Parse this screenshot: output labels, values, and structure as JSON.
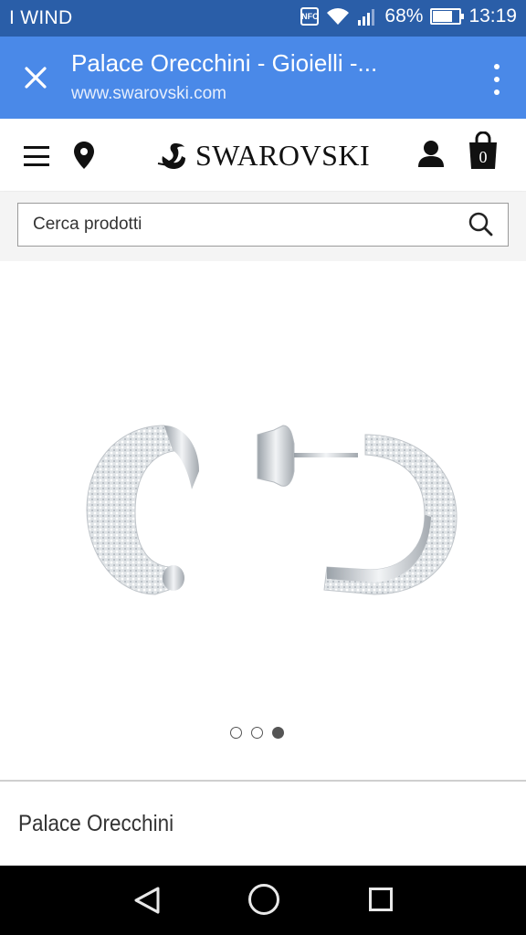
{
  "status_bar": {
    "carrier": "I WIND",
    "battery_text": "68%",
    "battery_level": 0.68,
    "time": "13:19",
    "nfc_label": "NFC",
    "icons": [
      "nfc-icon",
      "wifi-icon",
      "signal-icon",
      "battery-icon"
    ]
  },
  "custom_tab": {
    "title": "Palace Orecchini - Gioielli -...",
    "url": "www.swarovski.com",
    "icons": [
      "close-icon",
      "overflow-menu-icon"
    ]
  },
  "site_header": {
    "brand": "SWAROVSKI",
    "icons": [
      "hamburger-menu-icon",
      "location-pin-icon",
      "swan-logo-icon",
      "user-icon",
      "shopping-bag-icon"
    ],
    "bag_count": "0"
  },
  "search": {
    "placeholder": "Cerca prodotti"
  },
  "gallery": {
    "slides": 3,
    "active_slide": 3
  },
  "product": {
    "title": "Palace Orecchini"
  },
  "colors": {
    "status_bar": "#2a5ea8",
    "tab_bar": "#4a89e8",
    "nav_bar": "#000000"
  },
  "nav_bar": {
    "icons": [
      "back-icon",
      "home-icon",
      "recent-apps-icon"
    ]
  }
}
